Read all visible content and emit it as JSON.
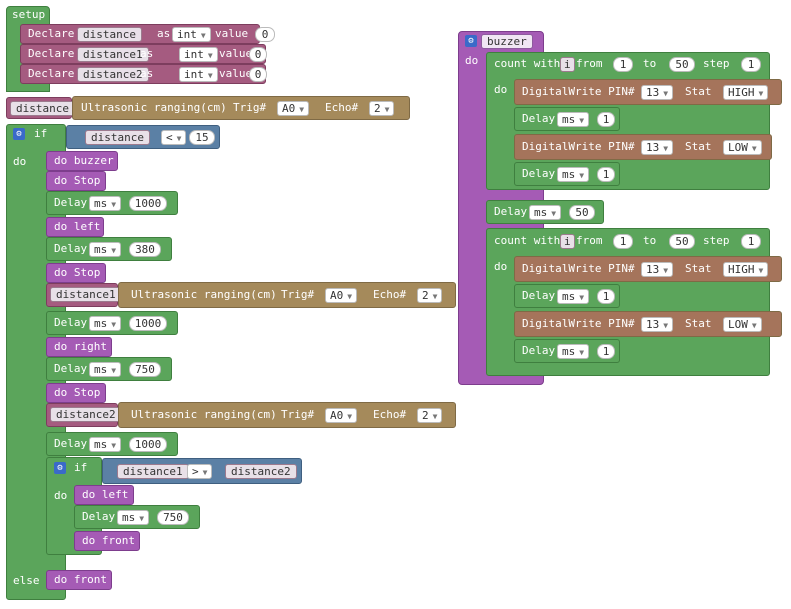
{
  "kw": {
    "setup": "setup",
    "declare": "Declare",
    "as": "as",
    "value": "value",
    "ultra": "Ultrasonic ranging(cm)",
    "trig": "Trig#",
    "echo": "Echo#",
    "if": "if",
    "do": "do",
    "else": "else",
    "delay": "Delay",
    "count_with": "count with",
    "from": "from",
    "to": "to",
    "step": "step",
    "digitalwrite": "DigitalWrite PIN#",
    "stat": "Stat"
  },
  "vars": {
    "d0": "distance",
    "d1": "distance1",
    "d2": "distance2",
    "i": "i"
  },
  "types": {
    "int": "int"
  },
  "values": {
    "zero": "0"
  },
  "ops": {
    "lt": "<",
    "gt": ">"
  },
  "pins": {
    "a0": "A0",
    "two": "2",
    "thirteen": "13"
  },
  "nums": {
    "n15": "15",
    "n1000": "1000",
    "n380": "380",
    "n750": "750",
    "n1": "1",
    "n50": "50"
  },
  "units": {
    "ms": "ms"
  },
  "states": {
    "high": "HIGH",
    "low": "LOW"
  },
  "funcs": {
    "buzzer": "buzzer",
    "stop": "Stop",
    "left": "left",
    "right": "right",
    "front": "front",
    "do_buzzer": "do buzzer",
    "do_stop": "do Stop",
    "do_left": "do left",
    "do_right": "do right",
    "do_front": "do front"
  },
  "colors": {
    "logic_green": "#5ba55b",
    "var_red": "#a55b80",
    "proc_purple": "#a55bb5",
    "sensor_tan": "#a58a5b",
    "compare_blue": "#5b80a5",
    "gear_blue": "#3a6ac9"
  }
}
